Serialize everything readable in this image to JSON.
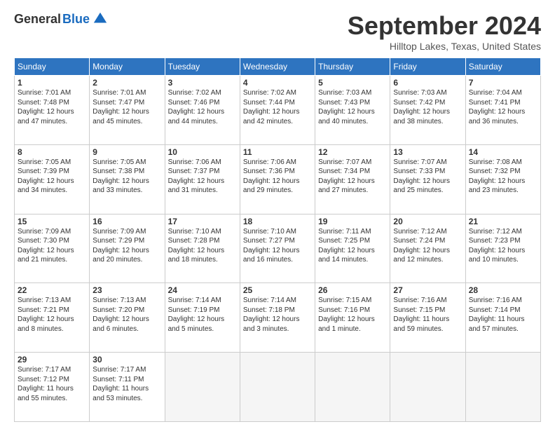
{
  "header": {
    "logo_general": "General",
    "logo_blue": "Blue",
    "month_title": "September 2024",
    "location": "Hilltop Lakes, Texas, United States"
  },
  "days_of_week": [
    "Sunday",
    "Monday",
    "Tuesday",
    "Wednesday",
    "Thursday",
    "Friday",
    "Saturday"
  ],
  "weeks": [
    [
      {
        "day": "1",
        "info": "Sunrise: 7:01 AM\nSunset: 7:48 PM\nDaylight: 12 hours\nand 47 minutes."
      },
      {
        "day": "2",
        "info": "Sunrise: 7:01 AM\nSunset: 7:47 PM\nDaylight: 12 hours\nand 45 minutes."
      },
      {
        "day": "3",
        "info": "Sunrise: 7:02 AM\nSunset: 7:46 PM\nDaylight: 12 hours\nand 44 minutes."
      },
      {
        "day": "4",
        "info": "Sunrise: 7:02 AM\nSunset: 7:44 PM\nDaylight: 12 hours\nand 42 minutes."
      },
      {
        "day": "5",
        "info": "Sunrise: 7:03 AM\nSunset: 7:43 PM\nDaylight: 12 hours\nand 40 minutes."
      },
      {
        "day": "6",
        "info": "Sunrise: 7:03 AM\nSunset: 7:42 PM\nDaylight: 12 hours\nand 38 minutes."
      },
      {
        "day": "7",
        "info": "Sunrise: 7:04 AM\nSunset: 7:41 PM\nDaylight: 12 hours\nand 36 minutes."
      }
    ],
    [
      {
        "day": "8",
        "info": "Sunrise: 7:05 AM\nSunset: 7:39 PM\nDaylight: 12 hours\nand 34 minutes."
      },
      {
        "day": "9",
        "info": "Sunrise: 7:05 AM\nSunset: 7:38 PM\nDaylight: 12 hours\nand 33 minutes."
      },
      {
        "day": "10",
        "info": "Sunrise: 7:06 AM\nSunset: 7:37 PM\nDaylight: 12 hours\nand 31 minutes."
      },
      {
        "day": "11",
        "info": "Sunrise: 7:06 AM\nSunset: 7:36 PM\nDaylight: 12 hours\nand 29 minutes."
      },
      {
        "day": "12",
        "info": "Sunrise: 7:07 AM\nSunset: 7:34 PM\nDaylight: 12 hours\nand 27 minutes."
      },
      {
        "day": "13",
        "info": "Sunrise: 7:07 AM\nSunset: 7:33 PM\nDaylight: 12 hours\nand 25 minutes."
      },
      {
        "day": "14",
        "info": "Sunrise: 7:08 AM\nSunset: 7:32 PM\nDaylight: 12 hours\nand 23 minutes."
      }
    ],
    [
      {
        "day": "15",
        "info": "Sunrise: 7:09 AM\nSunset: 7:30 PM\nDaylight: 12 hours\nand 21 minutes."
      },
      {
        "day": "16",
        "info": "Sunrise: 7:09 AM\nSunset: 7:29 PM\nDaylight: 12 hours\nand 20 minutes."
      },
      {
        "day": "17",
        "info": "Sunrise: 7:10 AM\nSunset: 7:28 PM\nDaylight: 12 hours\nand 18 minutes."
      },
      {
        "day": "18",
        "info": "Sunrise: 7:10 AM\nSunset: 7:27 PM\nDaylight: 12 hours\nand 16 minutes."
      },
      {
        "day": "19",
        "info": "Sunrise: 7:11 AM\nSunset: 7:25 PM\nDaylight: 12 hours\nand 14 minutes."
      },
      {
        "day": "20",
        "info": "Sunrise: 7:12 AM\nSunset: 7:24 PM\nDaylight: 12 hours\nand 12 minutes."
      },
      {
        "day": "21",
        "info": "Sunrise: 7:12 AM\nSunset: 7:23 PM\nDaylight: 12 hours\nand 10 minutes."
      }
    ],
    [
      {
        "day": "22",
        "info": "Sunrise: 7:13 AM\nSunset: 7:21 PM\nDaylight: 12 hours\nand 8 minutes."
      },
      {
        "day": "23",
        "info": "Sunrise: 7:13 AM\nSunset: 7:20 PM\nDaylight: 12 hours\nand 6 minutes."
      },
      {
        "day": "24",
        "info": "Sunrise: 7:14 AM\nSunset: 7:19 PM\nDaylight: 12 hours\nand 5 minutes."
      },
      {
        "day": "25",
        "info": "Sunrise: 7:14 AM\nSunset: 7:18 PM\nDaylight: 12 hours\nand 3 minutes."
      },
      {
        "day": "26",
        "info": "Sunrise: 7:15 AM\nSunset: 7:16 PM\nDaylight: 12 hours\nand 1 minute."
      },
      {
        "day": "27",
        "info": "Sunrise: 7:16 AM\nSunset: 7:15 PM\nDaylight: 11 hours\nand 59 minutes."
      },
      {
        "day": "28",
        "info": "Sunrise: 7:16 AM\nSunset: 7:14 PM\nDaylight: 11 hours\nand 57 minutes."
      }
    ],
    [
      {
        "day": "29",
        "info": "Sunrise: 7:17 AM\nSunset: 7:12 PM\nDaylight: 11 hours\nand 55 minutes."
      },
      {
        "day": "30",
        "info": "Sunrise: 7:17 AM\nSunset: 7:11 PM\nDaylight: 11 hours\nand 53 minutes."
      },
      {
        "day": "",
        "info": ""
      },
      {
        "day": "",
        "info": ""
      },
      {
        "day": "",
        "info": ""
      },
      {
        "day": "",
        "info": ""
      },
      {
        "day": "",
        "info": ""
      }
    ]
  ]
}
